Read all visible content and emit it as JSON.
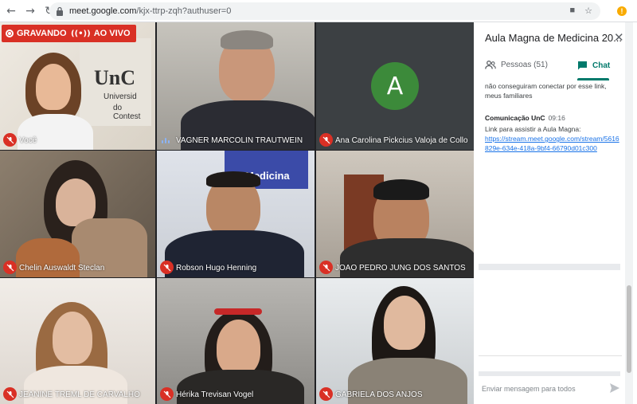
{
  "browser": {
    "url_host": "meet.google.com",
    "url_path": "/kjx-ttrp-zqh?authuser=0"
  },
  "meeting": {
    "recording_label": "GRAVANDO",
    "live_label": "AO VIVO"
  },
  "participants": [
    {
      "name": "Você",
      "muted": true
    },
    {
      "name": "VAGNER MARCOLIN TRAUTWEIN",
      "muted": false,
      "speaking": true
    },
    {
      "name": "Ana Carolina Pickcius Valoja de Collo",
      "muted": true,
      "avatar_letter": "A"
    },
    {
      "name": "Chelin Auswaldt Steclan",
      "muted": true
    },
    {
      "name": "Robson Hugo Henning",
      "muted": true
    },
    {
      "name": "JOAO PEDRO JUNG DOS SANTOS",
      "muted": true
    },
    {
      "name": "JEANINE TREML DE CARVALHO",
      "muted": true
    },
    {
      "name": "Hérika Trevisan Vogel",
      "muted": true
    },
    {
      "name": "GABRIELA DOS ANJOS",
      "muted": true
    }
  ],
  "background_text": {
    "unc_logo": "UnC",
    "unc_sub1": "Universid",
    "unc_sub2": "do Contest",
    "medicina": "Medicina"
  },
  "panel": {
    "title": "Aula Magna de Medicina 20...",
    "tab_people": "Pessoas (51)",
    "tab_chat": "Chat",
    "prev_message": "não conseguiram conectar por esse link, meus familiares",
    "message": {
      "sender": "Comunicação UnC",
      "time": "09:16",
      "text": "Link para assistir a Aula Magna:",
      "link": "https://stream.meet.google.com/stream/5616829e-634e-418a-9bf4-66790d01c300"
    },
    "input_placeholder": "Enviar mensagem para todos"
  },
  "colors": {
    "accent": "#00796b",
    "record": "#d93025",
    "avatar": "#3c8a3a"
  }
}
